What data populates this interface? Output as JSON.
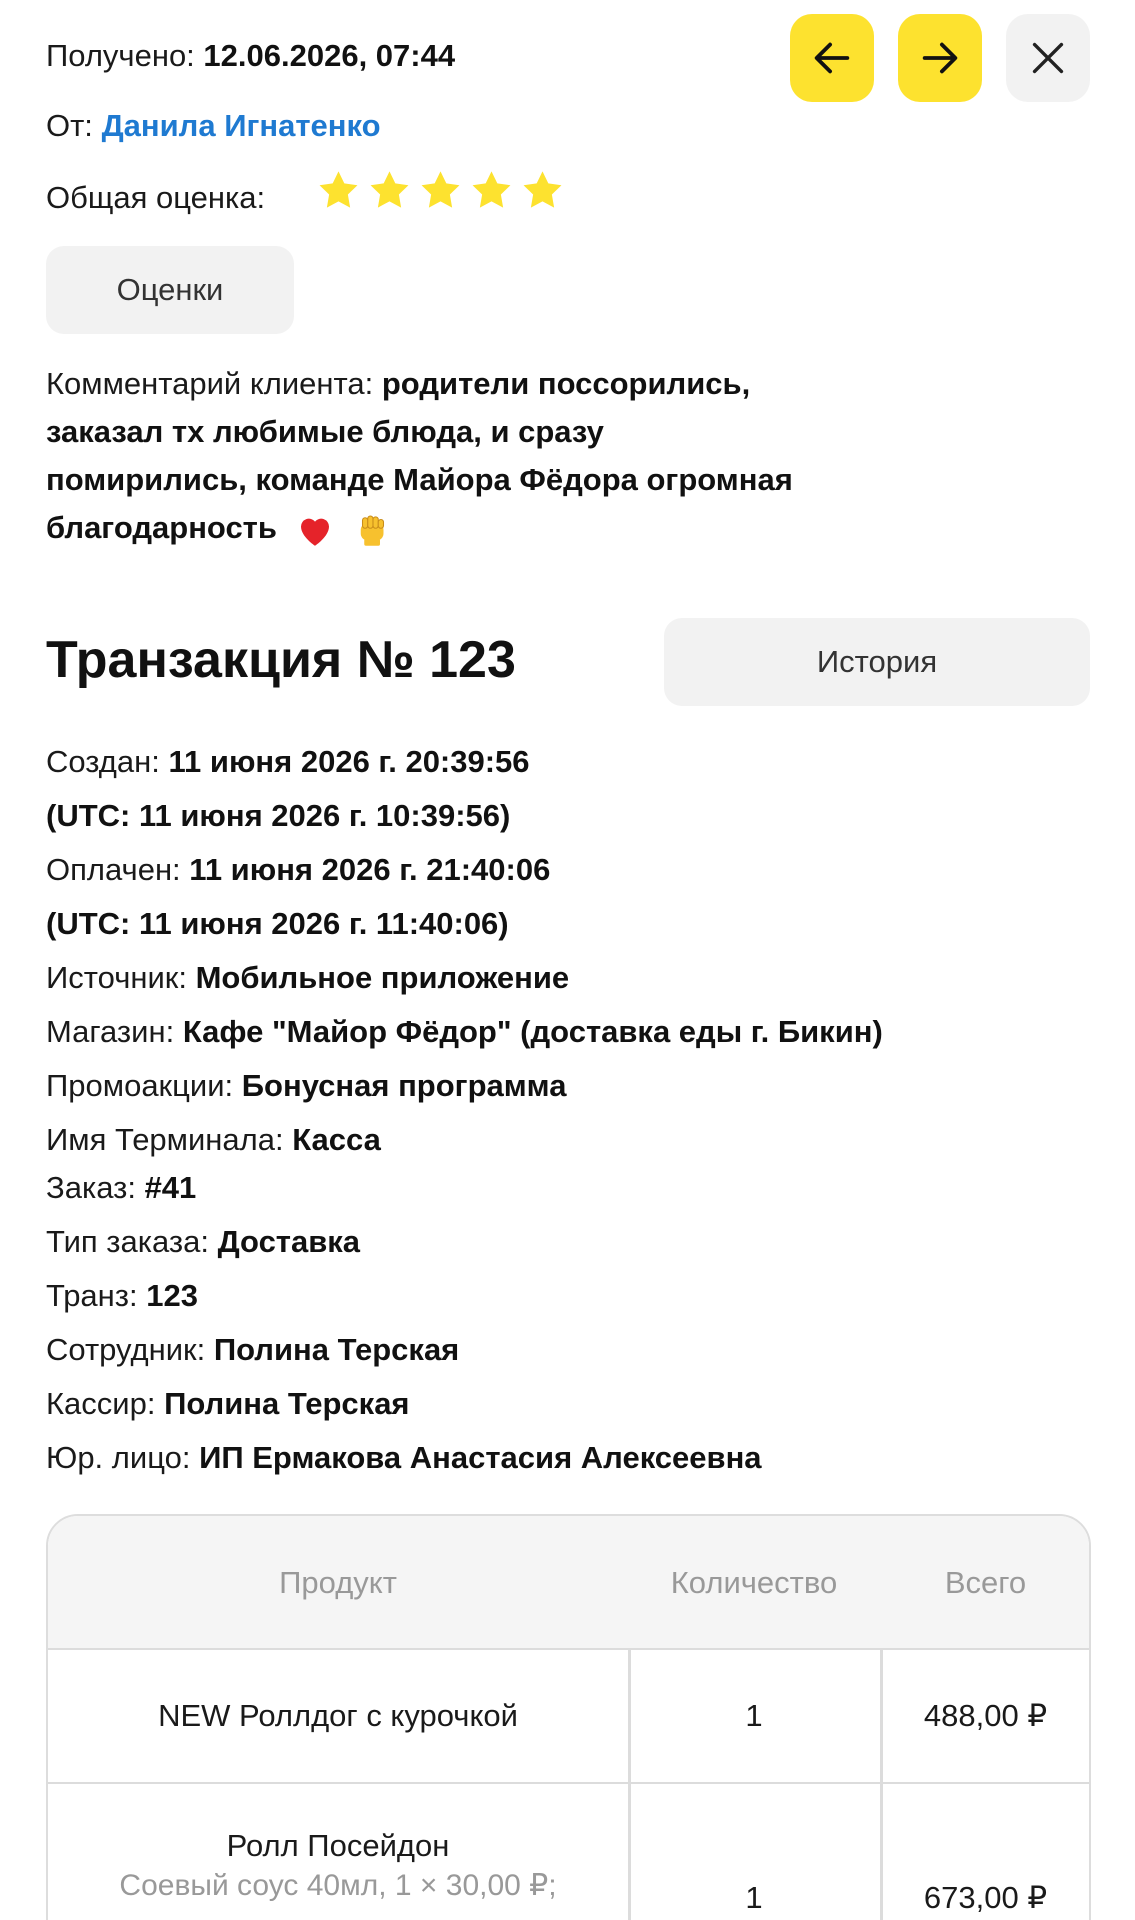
{
  "header": {
    "received_label": "Получено:",
    "received_value": "12.06.2026, 07:44",
    "from_label": "От:",
    "from_value": "Данила Игнатенко",
    "rating_label": "Общая оценка:",
    "rating_value": 5,
    "rating_max": 5,
    "ratings_button": "Оценки"
  },
  "comment": {
    "label": "Комментарий клиента:",
    "text": "родители поссорились, заказал тх любимые блюда, и сразу помирились, команде Майора Фёдора огромная благодарность",
    "emojis": [
      "red-heart",
      "raised-fist"
    ]
  },
  "transaction": {
    "title": "Транзакция № 123",
    "history_button": "История",
    "fields": [
      {
        "label": "Создан:",
        "value": "11 июня 2026 г. 20:39:56"
      },
      {
        "label": "",
        "value": "(UTC: 11 июня 2026 г. 10:39:56)"
      },
      {
        "label": "Оплачен:",
        "value": "11 июня 2026 г. 21:40:06"
      },
      {
        "label": "",
        "value": "(UTC: 11 июня 2026 г. 11:40:06)"
      },
      {
        "label": "Источник:",
        "value": "Мобильное приложение"
      },
      {
        "label": "Магазин:",
        "value": "Кафе \"Майор Фёдор\" (доставка еды г. Бикин)"
      },
      {
        "label": "Промоакции:",
        "value": "Бонусная программа"
      },
      {
        "label": "Имя Терминала:",
        "value": "Касса"
      },
      {
        "label": "Заказ:",
        "value": "#41"
      },
      {
        "label": "Тип заказа:",
        "value": "Доставка"
      },
      {
        "label": "Транз:",
        "value": "123"
      },
      {
        "label": "Сотрудник:",
        "value": "Полина Терская"
      },
      {
        "label": "Кассир:",
        "value": "Полина Терская"
      },
      {
        "label": "Юр. лицо:",
        "value": "ИП Ермакова Анастасия Алексеевна"
      }
    ]
  },
  "table": {
    "headers": [
      "Продукт",
      "Количество",
      "Всего"
    ],
    "rows": [
      {
        "product": "NEW Роллдог с курочкой",
        "modifier": "",
        "qty": "1",
        "total": "488,00 ₽"
      },
      {
        "product": "Ролл Посейдон",
        "modifier": "Соевый соус 40мл, 1 × 30,00 ₽;",
        "qty": "1",
        "total": "673,00 ₽"
      }
    ]
  },
  "colors": {
    "accent_yellow": "#fde22f",
    "link_blue": "#1f7ad1",
    "star_yellow": "#fde22f",
    "pill_grey": "#f2f2f2"
  },
  "icons": [
    "arrow-left-icon",
    "arrow-right-icon",
    "close-icon",
    "star-icon",
    "heart-emoji-icon",
    "fist-emoji-icon"
  ]
}
